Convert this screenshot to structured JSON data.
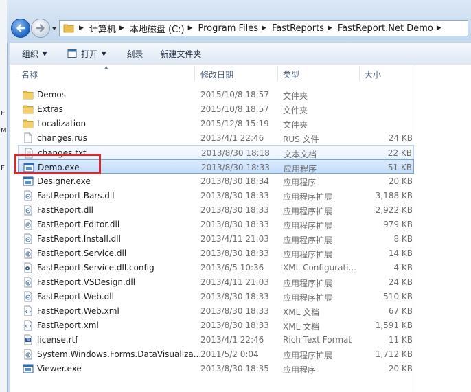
{
  "address": {
    "crumbs": [
      "计算机",
      "本地磁盘 (C:)",
      "Program Files",
      "FastReports",
      "FastReport.Net Demo"
    ]
  },
  "toolbar": {
    "organize": "组织",
    "open": "打开",
    "burn": "刻录",
    "new_folder": "新建文件夹"
  },
  "columns": {
    "name": "名称",
    "date": "修改日期",
    "type": "类型",
    "size": "大小"
  },
  "files": [
    {
      "name": "Demos",
      "date": "2015/10/8 18:57",
      "type": "文件夹",
      "size": "",
      "icon": "folder-icon"
    },
    {
      "name": "Extras",
      "date": "2015/10/8 18:57",
      "type": "文件夹",
      "size": "",
      "icon": "folder-icon"
    },
    {
      "name": "Localization",
      "date": "2015/12/8 15:19",
      "type": "文件夹",
      "size": "",
      "icon": "folder-icon"
    },
    {
      "name": "changes.rus",
      "date": "2013/4/1 22:46",
      "type": "RUS 文件",
      "size": "24 KB",
      "icon": "file-icon"
    },
    {
      "name": "changes.txt",
      "date": "2013/8/30 18:18",
      "type": "文本文档",
      "size": "22 KB",
      "icon": "text-file-icon"
    },
    {
      "name": "Demo.exe",
      "date": "2013/8/30 18:33",
      "type": "应用程序",
      "size": "51 KB",
      "icon": "app-icon"
    },
    {
      "name": "Designer.exe",
      "date": "2013/8/30 18:34",
      "type": "应用程序",
      "size": "20 KB",
      "icon": "app-icon"
    },
    {
      "name": "FastReport.Bars.dll",
      "date": "2013/8/30 18:33",
      "type": "应用程序扩展",
      "size": "3,188 KB",
      "icon": "dll-icon"
    },
    {
      "name": "FastReport.dll",
      "date": "2013/8/30 18:33",
      "type": "应用程序扩展",
      "size": "2,922 KB",
      "icon": "dll-icon"
    },
    {
      "name": "FastReport.Editor.dll",
      "date": "2013/8/30 18:33",
      "type": "应用程序扩展",
      "size": "979 KB",
      "icon": "dll-icon"
    },
    {
      "name": "FastReport.Install.dll",
      "date": "2013/4/11 21:03",
      "type": "应用程序扩展",
      "size": "8 KB",
      "icon": "dll-icon"
    },
    {
      "name": "FastReport.Service.dll",
      "date": "2013/8/30 18:33",
      "type": "应用程序扩展",
      "size": "14 KB",
      "icon": "dll-icon"
    },
    {
      "name": "FastReport.Service.dll.config",
      "date": "2013/6/5 10:36",
      "type": "XML Configurati...",
      "size": "4 KB",
      "icon": "config-icon"
    },
    {
      "name": "FastReport.VSDesign.dll",
      "date": "2013/4/11 21:03",
      "type": "应用程序扩展",
      "size": "24 KB",
      "icon": "dll-icon"
    },
    {
      "name": "FastReport.Web.dll",
      "date": "2013/8/30 18:33",
      "type": "应用程序扩展",
      "size": "510 KB",
      "icon": "dll-icon"
    },
    {
      "name": "FastReport.Web.xml",
      "date": "2013/8/30 18:33",
      "type": "XML 文档",
      "size": "67 KB",
      "icon": "xml-icon"
    },
    {
      "name": "FastReport.xml",
      "date": "2013/8/30 18:33",
      "type": "XML 文档",
      "size": "1,591 KB",
      "icon": "xml-icon"
    },
    {
      "name": "license.rtf",
      "date": "2013/4/1 22:46",
      "type": "Rich Text Format",
      "size": "11 KB",
      "icon": "rtf-icon"
    },
    {
      "name": "System.Windows.Forms.DataVisualiza...",
      "date": "2011/5/2 0:04",
      "type": "应用程序扩展",
      "size": "1,712 KB",
      "icon": "dll-icon"
    },
    {
      "name": "Viewer.exe",
      "date": "2013/8/30 18:35",
      "type": "应用程序",
      "size": "20 KB",
      "icon": "app-icon"
    }
  ]
}
